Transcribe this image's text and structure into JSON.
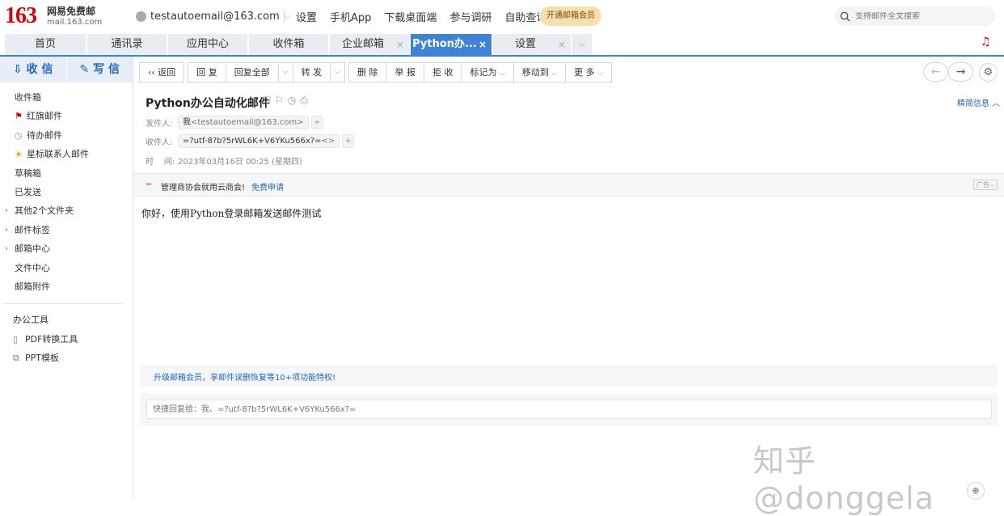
{
  "logo": {
    "number": "163",
    "line1": "网易免费邮",
    "line2": "mail.163.com"
  },
  "account": {
    "email": "testautoemail@163.com"
  },
  "top_links": [
    "设置",
    "手机App",
    "下载桌面端",
    "参与调研",
    "自助查询"
  ],
  "vip_button": "开通邮箱会员",
  "search": {
    "placeholder": "支持邮件全文搜索"
  },
  "tabs": [
    {
      "label": "首页"
    },
    {
      "label": "通讯录"
    },
    {
      "label": "应用中心"
    },
    {
      "label": "收件箱"
    },
    {
      "label": "企业邮箱"
    },
    {
      "label": "Python办..."
    },
    {
      "label": "设置"
    }
  ],
  "sidebar": {
    "receive": "收 信",
    "write": "写 信",
    "items": [
      "收件箱",
      "红旗邮件",
      "待办邮件",
      "星标联系人邮件",
      "草稿箱",
      "已发送",
      "其他2个文件夹",
      "邮件标签",
      "邮箱中心",
      "文件中心",
      "邮箱附件"
    ],
    "tools_title": "办公工具",
    "tools": [
      "PDF转换工具",
      "PPT模板"
    ]
  },
  "toolbar": {
    "back": "返回",
    "reply": "回 复",
    "reply_all": "回复全部",
    "forward": "转 发",
    "delete": "删 除",
    "report": "举 报",
    "reject": "拒 收",
    "mark_as": "标记为",
    "move_to": "移动到",
    "more": "更 多"
  },
  "mail": {
    "subject": "Python办公自动化邮件",
    "brief_info": "精简信息",
    "from_label": "发件人:",
    "from_name": "我",
    "from_addr": "<testautoemail@163.com>",
    "to_label": "收件人:",
    "to_value": "=?utf-8?b?5rWL6K+V6YKu566x?=",
    "to_addr": "<>",
    "time_label": "时    间:",
    "time_value": "2023年03月16日 00:25 (星期四)",
    "body": "你好，使用Python登录邮箱发送邮件测试"
  },
  "ad": {
    "text": "管理商协会就用云商会!",
    "link": "免费申请",
    "tag": "广告"
  },
  "upgrade_text": "升级邮箱会员，享邮件误删恢复等10+项功能特权!",
  "quick_reply": {
    "placeholder": "快捷回复给：我、=?utf-8?b?5rWL6K+V6YKu566x?="
  },
  "watermark": "知乎 @donggela"
}
